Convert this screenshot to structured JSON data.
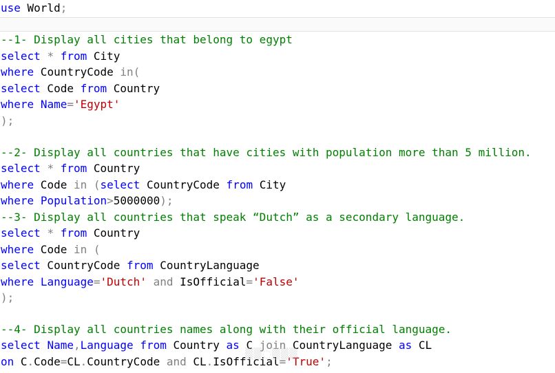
{
  "editor": {
    "colors": {
      "keyword": "#0000ff",
      "comment": "#008000",
      "string": "#c00000",
      "operator": "#808080",
      "text": "#000000",
      "background": "#ffffff"
    },
    "lines": [
      [
        [
          "k",
          "use"
        ],
        [
          "t",
          " World"
        ],
        [
          "o",
          ";"
        ]
      ],
      [],
      [
        [
          "c",
          "--1- Display all cities that belong to egypt"
        ]
      ],
      [
        [
          "k",
          "select"
        ],
        [
          "t",
          " "
        ],
        [
          "o",
          "*"
        ],
        [
          "t",
          " "
        ],
        [
          "k",
          "from"
        ],
        [
          "t",
          " City"
        ]
      ],
      [
        [
          "k",
          "where"
        ],
        [
          "t",
          " CountryCode "
        ],
        [
          "o",
          "in("
        ]
      ],
      [
        [
          "k",
          "select"
        ],
        [
          "t",
          " Code "
        ],
        [
          "k",
          "from"
        ],
        [
          "t",
          " Country"
        ]
      ],
      [
        [
          "k",
          "where"
        ],
        [
          "t",
          " "
        ],
        [
          "k",
          "Name"
        ],
        [
          "o",
          "="
        ],
        [
          "s",
          "'Egypt'"
        ]
      ],
      [
        [
          "o",
          ");"
        ]
      ],
      [],
      [
        [
          "c",
          "--2- Display all countries that have cities with population more than 5 million."
        ]
      ],
      [
        [
          "k",
          "select"
        ],
        [
          "t",
          " "
        ],
        [
          "o",
          "*"
        ],
        [
          "t",
          " "
        ],
        [
          "k",
          "from"
        ],
        [
          "t",
          " Country"
        ]
      ],
      [
        [
          "k",
          "where"
        ],
        [
          "t",
          " Code "
        ],
        [
          "o",
          "in"
        ],
        [
          "t",
          " "
        ],
        [
          "o",
          "("
        ],
        [
          "k",
          "select"
        ],
        [
          "t",
          " CountryCode "
        ],
        [
          "k",
          "from"
        ],
        [
          "t",
          " City"
        ]
      ],
      [
        [
          "k",
          "where"
        ],
        [
          "t",
          " "
        ],
        [
          "k",
          "Population"
        ],
        [
          "o",
          ">"
        ],
        [
          "n",
          "5000000"
        ],
        [
          "o",
          ");"
        ]
      ],
      [
        [
          "c",
          "--3- Display all countries that speak “Dutch” as a secondary language."
        ]
      ],
      [
        [
          "k",
          "select"
        ],
        [
          "t",
          " "
        ],
        [
          "o",
          "*"
        ],
        [
          "t",
          " "
        ],
        [
          "k",
          "from"
        ],
        [
          "t",
          " Country"
        ]
      ],
      [
        [
          "k",
          "where"
        ],
        [
          "t",
          " Code "
        ],
        [
          "o",
          "in"
        ],
        [
          "t",
          " "
        ],
        [
          "o",
          "("
        ]
      ],
      [
        [
          "k",
          "select"
        ],
        [
          "t",
          " CountryCode "
        ],
        [
          "k",
          "from"
        ],
        [
          "t",
          " CountryLanguage"
        ]
      ],
      [
        [
          "k",
          "where"
        ],
        [
          "t",
          " "
        ],
        [
          "k",
          "Language"
        ],
        [
          "o",
          "="
        ],
        [
          "s",
          "'Dutch'"
        ],
        [
          "t",
          " "
        ],
        [
          "o",
          "and"
        ],
        [
          "t",
          " IsOfficial"
        ],
        [
          "o",
          "="
        ],
        [
          "s",
          "'False'"
        ]
      ],
      [
        [
          "o",
          ");"
        ]
      ],
      [],
      [
        [
          "c",
          "--4- Display all countries names along with their official language."
        ]
      ],
      [
        [
          "k",
          "select"
        ],
        [
          "t",
          " "
        ],
        [
          "k",
          "Name"
        ],
        [
          "o",
          ","
        ],
        [
          "k",
          "Language"
        ],
        [
          "t",
          " "
        ],
        [
          "k",
          "from"
        ],
        [
          "t",
          " Country "
        ],
        [
          "k",
          "as"
        ],
        [
          "t",
          " C "
        ],
        [
          "o",
          "join"
        ],
        [
          "t",
          " CountryLanguage "
        ],
        [
          "k",
          "as"
        ],
        [
          "t",
          " CL"
        ]
      ],
      [
        [
          "k",
          "on"
        ],
        [
          "t",
          " C"
        ],
        [
          "o",
          "."
        ],
        [
          "t",
          "Code"
        ],
        [
          "o",
          "="
        ],
        [
          "t",
          "CL"
        ],
        [
          "o",
          "."
        ],
        [
          "t",
          "CountryCode "
        ],
        [
          "o",
          "and"
        ],
        [
          "t",
          " CL"
        ],
        [
          "o",
          "."
        ],
        [
          "t",
          "IsOfficial"
        ],
        [
          "o",
          "="
        ],
        [
          "s",
          "'True'"
        ],
        [
          "o",
          ";"
        ]
      ]
    ]
  }
}
